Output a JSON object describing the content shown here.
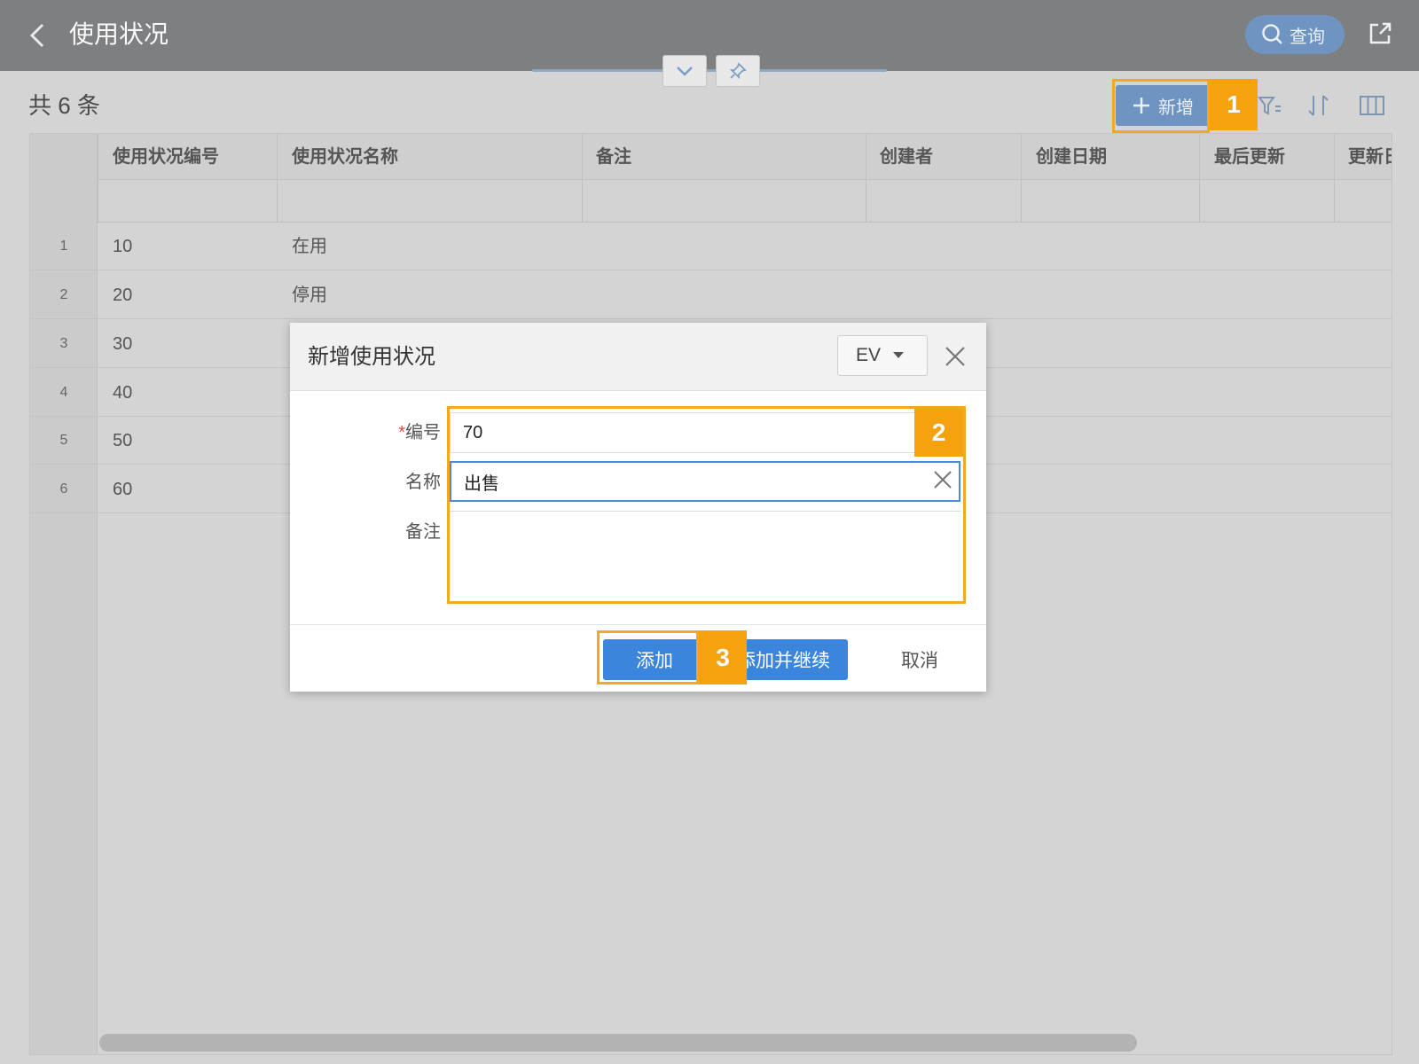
{
  "header": {
    "title": "使用状况",
    "query_label": "查询"
  },
  "toolbar": {
    "count_text": "共 6 条",
    "add_label": "新增"
  },
  "table": {
    "columns": [
      "使用状况编号",
      "使用状况名称",
      "备注",
      "创建者",
      "创建日期",
      "最后更新",
      "更新日"
    ],
    "rows": [
      {
        "num": "1",
        "code": "10",
        "name": "在用"
      },
      {
        "num": "2",
        "code": "20",
        "name": "停用"
      },
      {
        "num": "3",
        "code": "30",
        "name": ""
      },
      {
        "num": "4",
        "code": "40",
        "name": ""
      },
      {
        "num": "5",
        "code": "50",
        "name": ""
      },
      {
        "num": "6",
        "code": "60",
        "name": ""
      }
    ]
  },
  "dialog": {
    "title": "新增使用状况",
    "lang_value": "EV",
    "fields": {
      "code": {
        "required_mark": "*",
        "label": "编号",
        "value": "70"
      },
      "name": {
        "label": "名称",
        "value": "出售"
      },
      "remark": {
        "label": "备注",
        "value": ""
      }
    },
    "buttons": {
      "add": "添加",
      "add_continue": "添加并继续",
      "cancel": "取消"
    }
  },
  "callouts": [
    "1",
    "2",
    "3"
  ],
  "colors": {
    "header_bg": "#7d7f81",
    "primary": "#3b86dc",
    "callout": "#f5a623"
  }
}
